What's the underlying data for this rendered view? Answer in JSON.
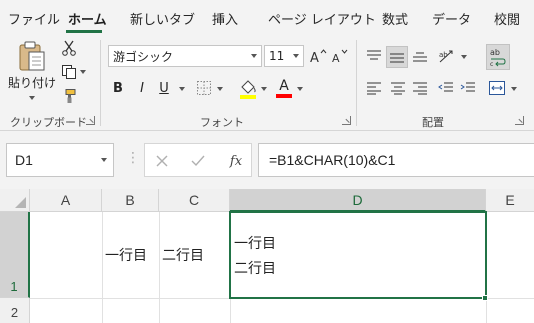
{
  "ribbon_tabs": [
    "ファイル",
    "ホーム",
    "新しいタブ",
    "挿入",
    "ページ レイアウト",
    "数式",
    "データ",
    "校閲"
  ],
  "active_tab": "ホーム",
  "clipboard": {
    "paste_label": "貼り付け",
    "group_label": "クリップボード"
  },
  "font": {
    "name": "游ゴシック",
    "size": "11",
    "bold": "B",
    "italic": "I",
    "underline": "U",
    "font_color_glyph": "A",
    "group_label": "フォント",
    "highlight_color": "#ffff00",
    "font_color": "#ff0000"
  },
  "alignment": {
    "group_label": "配置",
    "wrap_glyph": "ab"
  },
  "formula_bar": {
    "name_box": "D1",
    "formula": "=B1&CHAR(10)&C1",
    "fx_label": "fx"
  },
  "sheet": {
    "columns": [
      "A",
      "B",
      "C",
      "D",
      "E"
    ],
    "selected_column": "D",
    "rows": [
      "1",
      "2"
    ],
    "selected_row": "1",
    "cells": {
      "B1": "一行目",
      "C1": "二行目",
      "D1_line1": "一行目",
      "D1_line2": "二行目"
    }
  },
  "accent_color": "#217346"
}
